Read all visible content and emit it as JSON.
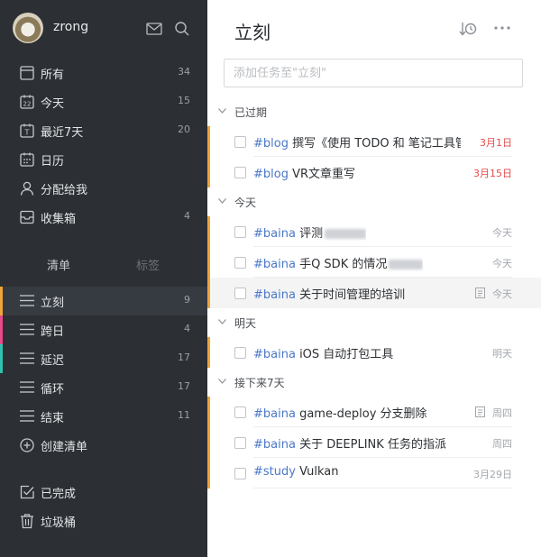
{
  "sidebar": {
    "username": "zrong",
    "nav": [
      {
        "label": "所有",
        "count": "34",
        "icon": "inbox-icon"
      },
      {
        "label": "今天",
        "count": "15",
        "icon": "calendar-22-icon"
      },
      {
        "label": "最近7天",
        "count": "20",
        "icon": "calendar-t-icon"
      },
      {
        "label": "日历",
        "count": "",
        "icon": "calendar-icon"
      },
      {
        "label": "分配给我",
        "count": "",
        "icon": "person-icon"
      },
      {
        "label": "收集箱",
        "count": "4",
        "icon": "tray-icon"
      }
    ],
    "tabs": {
      "lists": "清单",
      "tags": "标签"
    },
    "lists": [
      {
        "label": "立刻",
        "count": "9",
        "color": "#f0a53a"
      },
      {
        "label": "跨日",
        "count": "4",
        "color": "#e64a8a"
      },
      {
        "label": "延迟",
        "count": "17",
        "color": "#2fc2b0"
      },
      {
        "label": "循环",
        "count": "17",
        "color": ""
      },
      {
        "label": "结束",
        "count": "11",
        "color": ""
      }
    ],
    "create_list": "创建清单",
    "completed": "已完成",
    "trash": "垃圾桶"
  },
  "main": {
    "title": "立刻",
    "add_placeholder": "添加任务至\"立刻\"",
    "sections": [
      {
        "label": "已过期"
      },
      {
        "label": "今天"
      },
      {
        "label": "明天"
      },
      {
        "label": "接下来7天"
      }
    ],
    "tasks": [
      {
        "tag": "#blog",
        "text": " 撰写《使用 TODO 和 笔记工具管理工",
        "date": "3月1日",
        "overdue": true,
        "note": false
      },
      {
        "tag": "#blog",
        "text": " VR文章重写",
        "date": "3月15日",
        "overdue": true,
        "note": false
      },
      {
        "tag": "#baina",
        "text": " 评测",
        "date": "今天",
        "overdue": false,
        "note": false
      },
      {
        "tag": "#baina",
        "text": " 手Q SDK 的情况",
        "date": "今天",
        "overdue": false,
        "note": false
      },
      {
        "tag": "#baina",
        "text": " 关于时间管理的培训",
        "date": "今天",
        "overdue": false,
        "note": true
      },
      {
        "tag": "#baina",
        "text": " iOS 自动打包工具",
        "date": "明天",
        "overdue": false,
        "note": false
      },
      {
        "tag": "#baina",
        "text": " game-deploy 分支删除",
        "date": "周四",
        "overdue": false,
        "note": true
      },
      {
        "tag": "#baina",
        "text": " 关于 DEEPLINK 任务的指派",
        "date": "周四",
        "overdue": false,
        "note": false
      },
      {
        "tag": "#study",
        "text": " Vulkan",
        "date": "3月29日",
        "overdue": false,
        "note": false
      }
    ]
  },
  "colors": {
    "accent": "#f0a53a",
    "tag": "#4a78c8",
    "overdue": "#e24b4b",
    "sidebar": "#2c2f33"
  }
}
